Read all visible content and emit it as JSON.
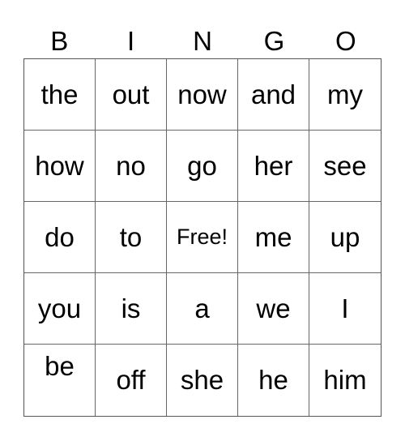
{
  "header": [
    "B",
    "I",
    "N",
    "G",
    "O"
  ],
  "cells": [
    [
      "the",
      "out",
      "now",
      "and",
      "my"
    ],
    [
      "how",
      "no",
      "go",
      "her",
      "see"
    ],
    [
      "do",
      "to",
      "Free!",
      "me",
      "up"
    ],
    [
      "you",
      "is",
      "a",
      "we",
      "I"
    ],
    [
      "be",
      "off",
      "she",
      "he",
      "him"
    ]
  ]
}
